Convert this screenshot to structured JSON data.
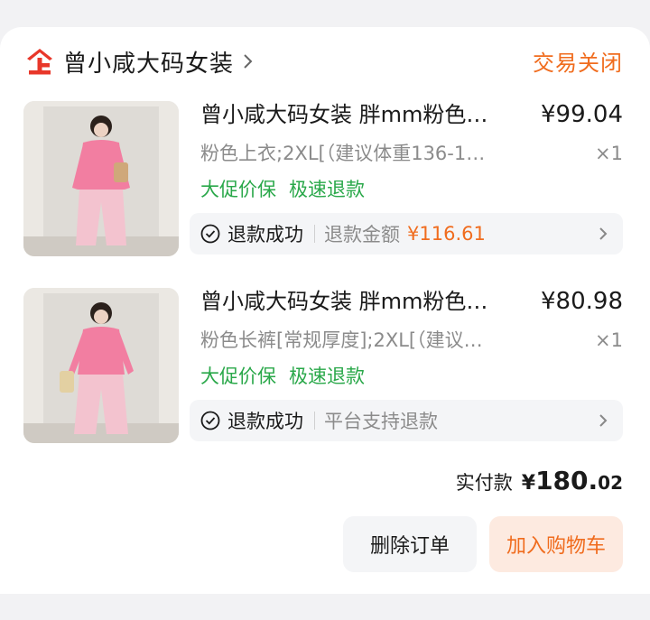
{
  "order": {
    "shop_name": "曾小咸大码女装",
    "status": "交易关闭",
    "items": [
      {
        "title": "曾小咸大码女装 胖mm粉色…",
        "price": "¥99.04",
        "spec": "粉色上衣;2XL[（建议体重136-1…",
        "qty": "×1",
        "tags": [
          "大促价保",
          "极速退款"
        ],
        "refund_status": "退款成功",
        "refund_note": "退款金额",
        "refund_amount": "¥116.61"
      },
      {
        "title": "曾小咸大码女装 胖mm粉色…",
        "price": "¥80.98",
        "spec": "粉色长裤[常规厚度];2XL[（建议…",
        "qty": "×1",
        "tags": [
          "大促价保",
          "极速退款"
        ],
        "refund_status": "退款成功",
        "refund_note": "平台支持退款",
        "refund_amount": ""
      }
    ],
    "total_label": "实付款",
    "total_currency": "¥",
    "total_int": "180.",
    "total_decimal": "02",
    "buttons": {
      "delete": "删除订单",
      "add_to_cart": "加入购物车"
    }
  },
  "colors": {
    "accent": "#f06c1e",
    "green_tag": "#2aa84a",
    "shop_logo": "#e8372a"
  },
  "icons": {
    "shop": "shop-logo-icon",
    "chevron": "chevron-right-icon",
    "check": "check-circle-icon"
  }
}
